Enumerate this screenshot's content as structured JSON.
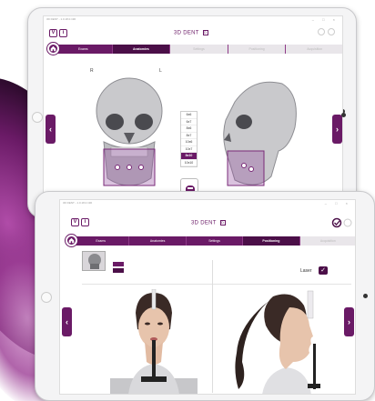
{
  "colors": {
    "accent": "#6a1a66",
    "accent_dark": "#4b0f48",
    "inactive_tab": "#e9e6ea"
  },
  "back_tablet": {
    "titlebar": "3D DENT - 1.0.18.0.190",
    "header": {
      "btn_v": "V",
      "btn_i": "i",
      "brand": "3D DENT",
      "brand_icon": "D"
    },
    "tabs": [
      {
        "label": "Exams",
        "state": "normal"
      },
      {
        "label": "Anatomies",
        "state": "active"
      },
      {
        "label": "Settings",
        "state": "inactive"
      },
      {
        "label": "Positioning",
        "state": "inactive"
      },
      {
        "label": "Acquisition",
        "state": "inactive"
      }
    ],
    "skull_labels": {
      "right": "R",
      "left": "L"
    },
    "fov_sizes": [
      "6x6",
      "6x7",
      "8x6",
      "8x7",
      "10x6",
      "10x7",
      "8x10",
      "10x10"
    ],
    "fov_selected": "8x10",
    "icons": [
      "home-icon",
      "chevron-left-icon",
      "chevron-right-icon",
      "sensor-icon"
    ]
  },
  "front_tablet": {
    "titlebar": "3D DENT - 1.0.18.0.190",
    "header": {
      "btn_v": "V",
      "btn_i": "i",
      "brand": "3D DENT",
      "brand_icon": "D"
    },
    "tabs": [
      {
        "label": "Exams",
        "state": "normal"
      },
      {
        "label": "Anatomies",
        "state": "normal"
      },
      {
        "label": "Settings",
        "state": "normal"
      },
      {
        "label": "Positioning",
        "state": "active"
      },
      {
        "label": "Acquisition",
        "state": "inactive"
      }
    ],
    "laser_label": "Laser",
    "laser_checked": true,
    "check_glyph": "✓",
    "icons": [
      "home-icon",
      "chevron-left-icon",
      "chevron-right-icon",
      "check-icon",
      "settings-icon"
    ]
  }
}
